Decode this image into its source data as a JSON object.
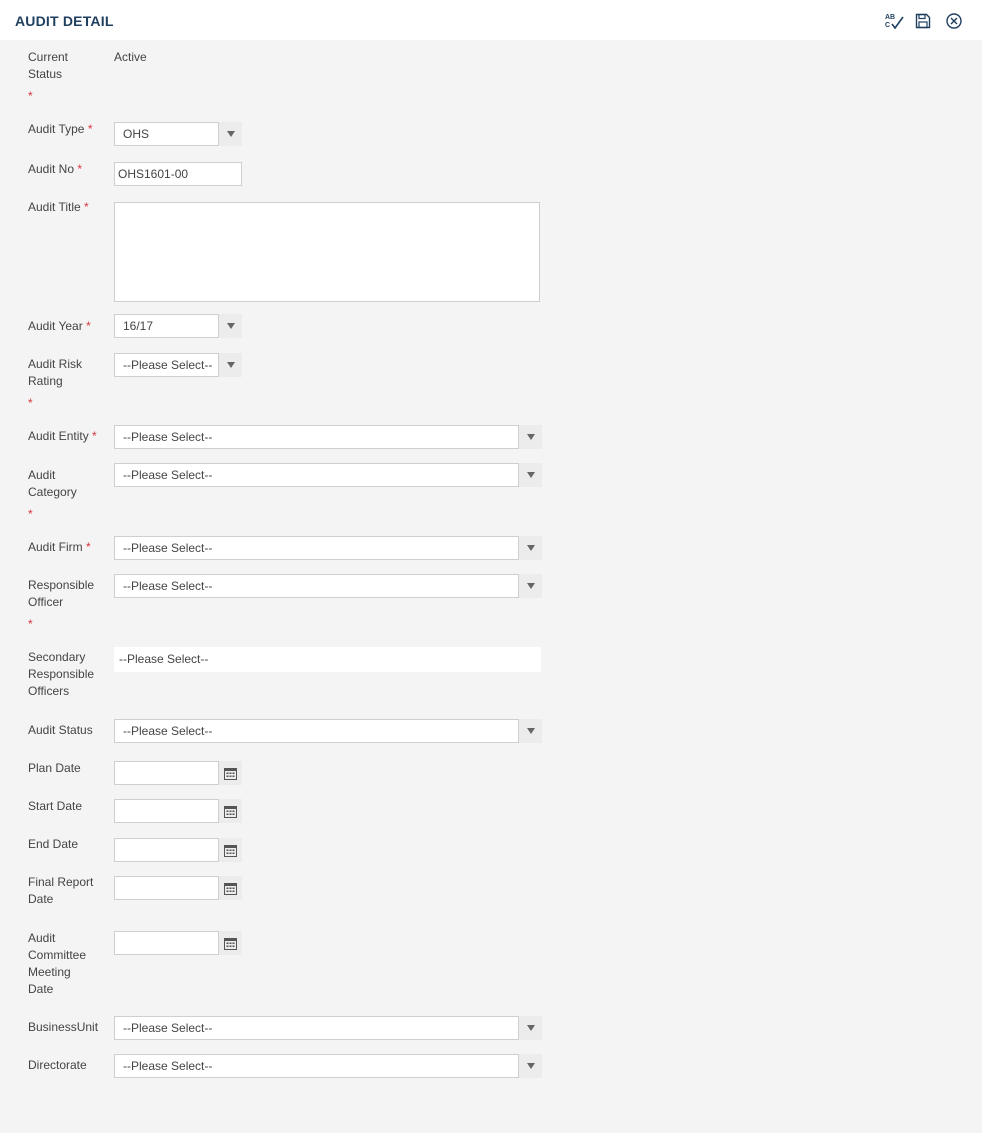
{
  "header": {
    "title": "AUDIT DETAIL",
    "icons": [
      "spellcheck-icon",
      "save-icon",
      "close-icon"
    ]
  },
  "form": {
    "current_status": {
      "label": "Current Status",
      "value": "Active"
    },
    "audit_type": {
      "label": "Audit Type",
      "value": "OHS"
    },
    "audit_no": {
      "label": "Audit No",
      "value": "OHS1601-00"
    },
    "audit_title": {
      "label": "Audit Title",
      "value": ""
    },
    "audit_year": {
      "label": "Audit Year",
      "value": "16/17"
    },
    "audit_risk_rating": {
      "label": "Audit Risk Rating",
      "value": "--Please Select--"
    },
    "audit_entity": {
      "label": "Audit Entity",
      "value": "--Please Select--"
    },
    "audit_category": {
      "label": "Audit Category",
      "value": "--Please Select--"
    },
    "audit_firm": {
      "label": "Audit Firm",
      "value": "--Please Select--"
    },
    "responsible_officer": {
      "label": "Responsible Officer",
      "value": "--Please Select--"
    },
    "secondary_responsible_officers": {
      "label": "Secondary Responsible Officers",
      "value": "--Please Select--"
    },
    "audit_status": {
      "label": "Audit Status",
      "value": "--Please Select--"
    },
    "plan_date": {
      "label": "Plan Date",
      "value": ""
    },
    "start_date": {
      "label": "Start Date",
      "value": ""
    },
    "end_date": {
      "label": "End Date",
      "value": ""
    },
    "final_report_date": {
      "label": "Final Report Date",
      "value": ""
    },
    "audit_committee_meeting_date": {
      "label": "Audit Committee Meeting Date",
      "value": ""
    },
    "business_unit": {
      "label": "BusinessUnit",
      "value": "--Please Select--"
    },
    "directorate": {
      "label": "Directorate",
      "value": "--Please Select--"
    },
    "required_marker": "*"
  },
  "colors": {
    "header_title": "#1f3f5f",
    "required": "#d9343b",
    "background": "#f4f4f4"
  }
}
